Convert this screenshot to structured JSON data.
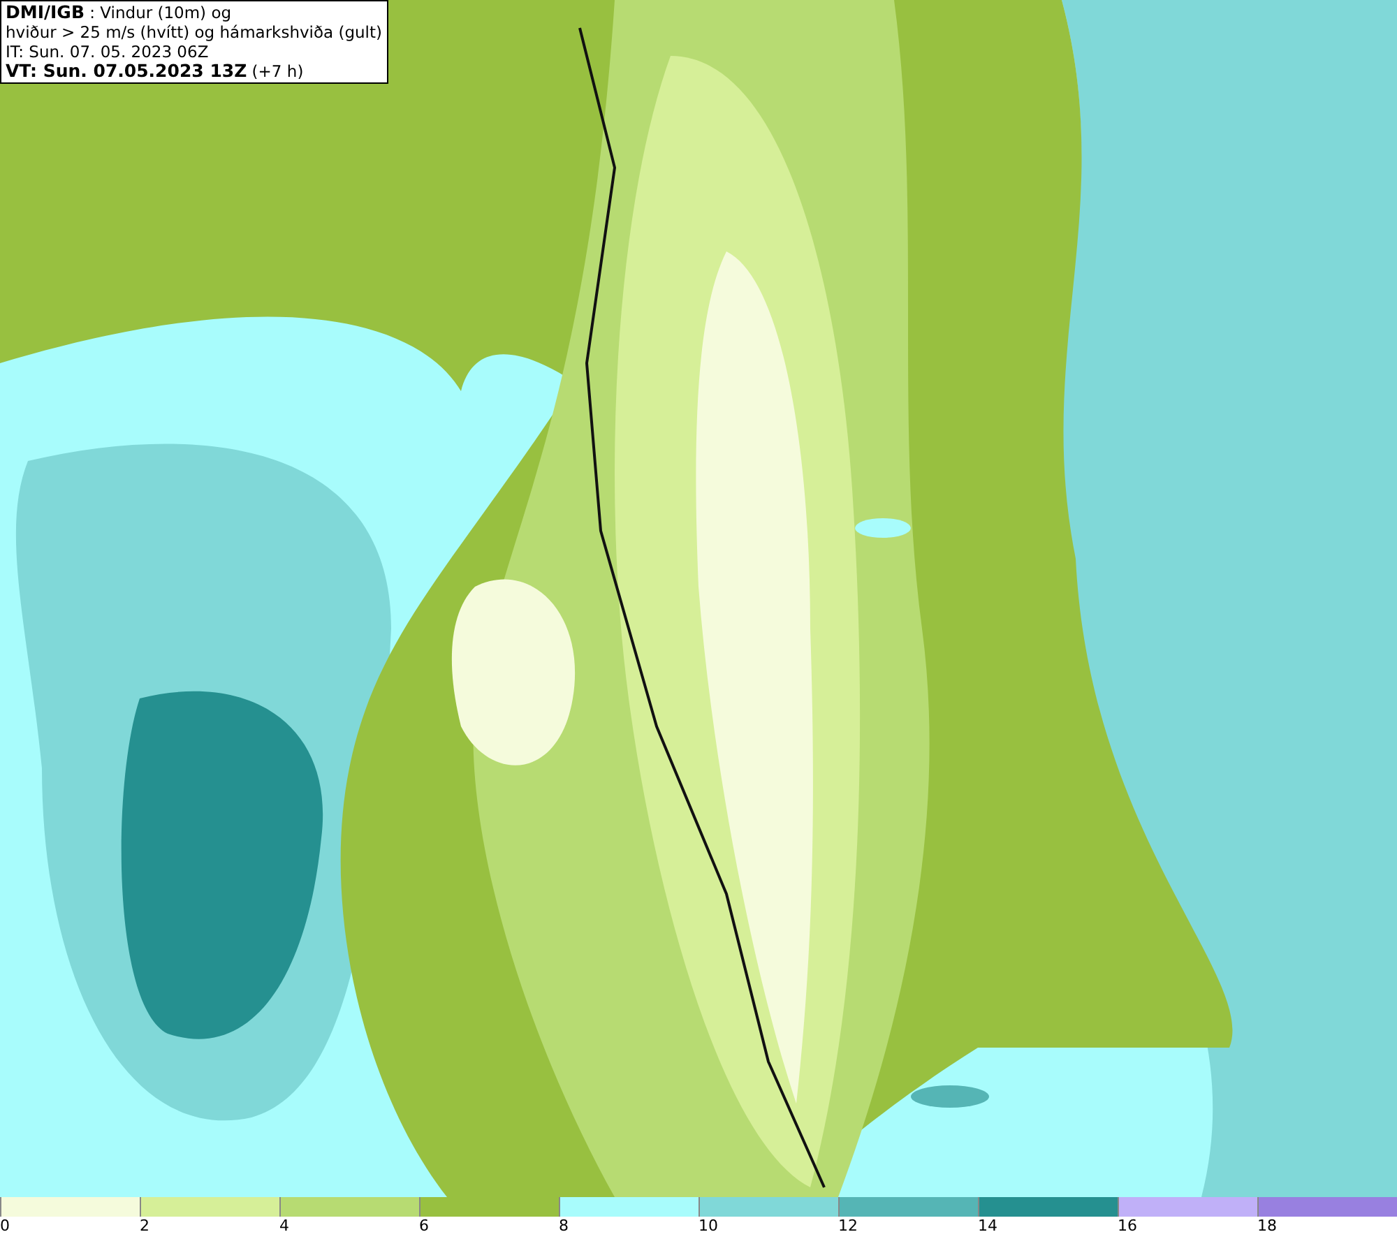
{
  "header": {
    "lines": [
      "**DMI/IGB** : Vindur (10m) og",
      "hviður > 25 m/s (hvítt) og hámarkshviða (gult)",
      "IT: Sun. 07. 05. 2023 06Z",
      "**VT: Sun. 07.05.2023 13Z** (+7 h)"
    ]
  },
  "legend": [
    {
      "label": "0",
      "color": "#f5fbdc"
    },
    {
      "label": "2",
      "color": "#d6ef98"
    },
    {
      "label": "4",
      "color": "#b7db72"
    },
    {
      "label": "6",
      "color": "#98c040"
    },
    {
      "label": "8",
      "color": "#a8fcfc"
    },
    {
      "label": "10",
      "color": "#80d8d8"
    },
    {
      "label": "12",
      "color": "#55b5b5"
    },
    {
      "label": "14",
      "color": "#259090"
    },
    {
      "label": "16",
      "color": "#c0b0f8"
    },
    {
      "label": "18",
      "color": "#9880e0"
    }
  ]
}
